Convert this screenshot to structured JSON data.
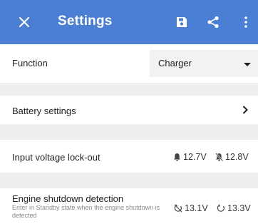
{
  "header": {
    "title": "Settings",
    "background": "#4a7fd4",
    "icons": [
      "close-icon",
      "save-icon",
      "share-icon",
      "more-vert-icon"
    ]
  },
  "function_row": {
    "label": "Function",
    "value": "Charger"
  },
  "battery_row": {
    "label": "Battery settings"
  },
  "lockout_row": {
    "label": "Input voltage lock-out",
    "on_value": "12.7V",
    "off_value": "12.8V"
  },
  "engine_row": {
    "label": "Engine shutdown detection",
    "description": "Enter in Standby state when the engine shutdown is detected",
    "stop_value": "13.1V",
    "start_value": "13.3V"
  }
}
